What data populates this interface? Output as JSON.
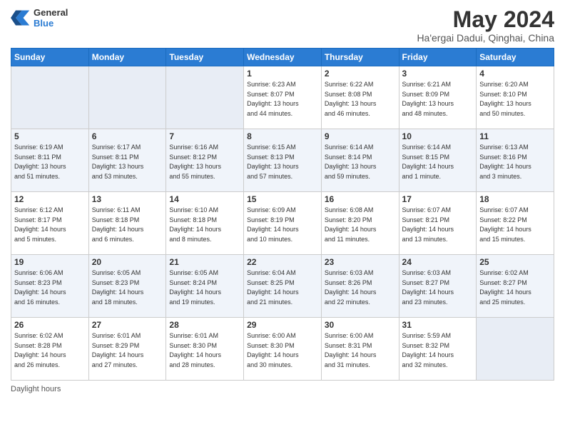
{
  "header": {
    "logo_line1": "General",
    "logo_line2": "Blue",
    "month_year": "May 2024",
    "location": "Ha'ergai Dadui, Qinghai, China"
  },
  "weekdays": [
    "Sunday",
    "Monday",
    "Tuesday",
    "Wednesday",
    "Thursday",
    "Friday",
    "Saturday"
  ],
  "footer": {
    "daylight_label": "Daylight hours"
  },
  "weeks": [
    [
      {
        "day": "",
        "info": ""
      },
      {
        "day": "",
        "info": ""
      },
      {
        "day": "",
        "info": ""
      },
      {
        "day": "1",
        "info": "Sunrise: 6:23 AM\nSunset: 8:07 PM\nDaylight: 13 hours\nand 44 minutes."
      },
      {
        "day": "2",
        "info": "Sunrise: 6:22 AM\nSunset: 8:08 PM\nDaylight: 13 hours\nand 46 minutes."
      },
      {
        "day": "3",
        "info": "Sunrise: 6:21 AM\nSunset: 8:09 PM\nDaylight: 13 hours\nand 48 minutes."
      },
      {
        "day": "4",
        "info": "Sunrise: 6:20 AM\nSunset: 8:10 PM\nDaylight: 13 hours\nand 50 minutes."
      }
    ],
    [
      {
        "day": "5",
        "info": "Sunrise: 6:19 AM\nSunset: 8:11 PM\nDaylight: 13 hours\nand 51 minutes."
      },
      {
        "day": "6",
        "info": "Sunrise: 6:17 AM\nSunset: 8:11 PM\nDaylight: 13 hours\nand 53 minutes."
      },
      {
        "day": "7",
        "info": "Sunrise: 6:16 AM\nSunset: 8:12 PM\nDaylight: 13 hours\nand 55 minutes."
      },
      {
        "day": "8",
        "info": "Sunrise: 6:15 AM\nSunset: 8:13 PM\nDaylight: 13 hours\nand 57 minutes."
      },
      {
        "day": "9",
        "info": "Sunrise: 6:14 AM\nSunset: 8:14 PM\nDaylight: 13 hours\nand 59 minutes."
      },
      {
        "day": "10",
        "info": "Sunrise: 6:14 AM\nSunset: 8:15 PM\nDaylight: 14 hours\nand 1 minute."
      },
      {
        "day": "11",
        "info": "Sunrise: 6:13 AM\nSunset: 8:16 PM\nDaylight: 14 hours\nand 3 minutes."
      }
    ],
    [
      {
        "day": "12",
        "info": "Sunrise: 6:12 AM\nSunset: 8:17 PM\nDaylight: 14 hours\nand 5 minutes."
      },
      {
        "day": "13",
        "info": "Sunrise: 6:11 AM\nSunset: 8:18 PM\nDaylight: 14 hours\nand 6 minutes."
      },
      {
        "day": "14",
        "info": "Sunrise: 6:10 AM\nSunset: 8:18 PM\nDaylight: 14 hours\nand 8 minutes."
      },
      {
        "day": "15",
        "info": "Sunrise: 6:09 AM\nSunset: 8:19 PM\nDaylight: 14 hours\nand 10 minutes."
      },
      {
        "day": "16",
        "info": "Sunrise: 6:08 AM\nSunset: 8:20 PM\nDaylight: 14 hours\nand 11 minutes."
      },
      {
        "day": "17",
        "info": "Sunrise: 6:07 AM\nSunset: 8:21 PM\nDaylight: 14 hours\nand 13 minutes."
      },
      {
        "day": "18",
        "info": "Sunrise: 6:07 AM\nSunset: 8:22 PM\nDaylight: 14 hours\nand 15 minutes."
      }
    ],
    [
      {
        "day": "19",
        "info": "Sunrise: 6:06 AM\nSunset: 8:23 PM\nDaylight: 14 hours\nand 16 minutes."
      },
      {
        "day": "20",
        "info": "Sunrise: 6:05 AM\nSunset: 8:23 PM\nDaylight: 14 hours\nand 18 minutes."
      },
      {
        "day": "21",
        "info": "Sunrise: 6:05 AM\nSunset: 8:24 PM\nDaylight: 14 hours\nand 19 minutes."
      },
      {
        "day": "22",
        "info": "Sunrise: 6:04 AM\nSunset: 8:25 PM\nDaylight: 14 hours\nand 21 minutes."
      },
      {
        "day": "23",
        "info": "Sunrise: 6:03 AM\nSunset: 8:26 PM\nDaylight: 14 hours\nand 22 minutes."
      },
      {
        "day": "24",
        "info": "Sunrise: 6:03 AM\nSunset: 8:27 PM\nDaylight: 14 hours\nand 23 minutes."
      },
      {
        "day": "25",
        "info": "Sunrise: 6:02 AM\nSunset: 8:27 PM\nDaylight: 14 hours\nand 25 minutes."
      }
    ],
    [
      {
        "day": "26",
        "info": "Sunrise: 6:02 AM\nSunset: 8:28 PM\nDaylight: 14 hours\nand 26 minutes."
      },
      {
        "day": "27",
        "info": "Sunrise: 6:01 AM\nSunset: 8:29 PM\nDaylight: 14 hours\nand 27 minutes."
      },
      {
        "day": "28",
        "info": "Sunrise: 6:01 AM\nSunset: 8:30 PM\nDaylight: 14 hours\nand 28 minutes."
      },
      {
        "day": "29",
        "info": "Sunrise: 6:00 AM\nSunset: 8:30 PM\nDaylight: 14 hours\nand 30 minutes."
      },
      {
        "day": "30",
        "info": "Sunrise: 6:00 AM\nSunset: 8:31 PM\nDaylight: 14 hours\nand 31 minutes."
      },
      {
        "day": "31",
        "info": "Sunrise: 5:59 AM\nSunset: 8:32 PM\nDaylight: 14 hours\nand 32 minutes."
      },
      {
        "day": "",
        "info": ""
      }
    ]
  ]
}
